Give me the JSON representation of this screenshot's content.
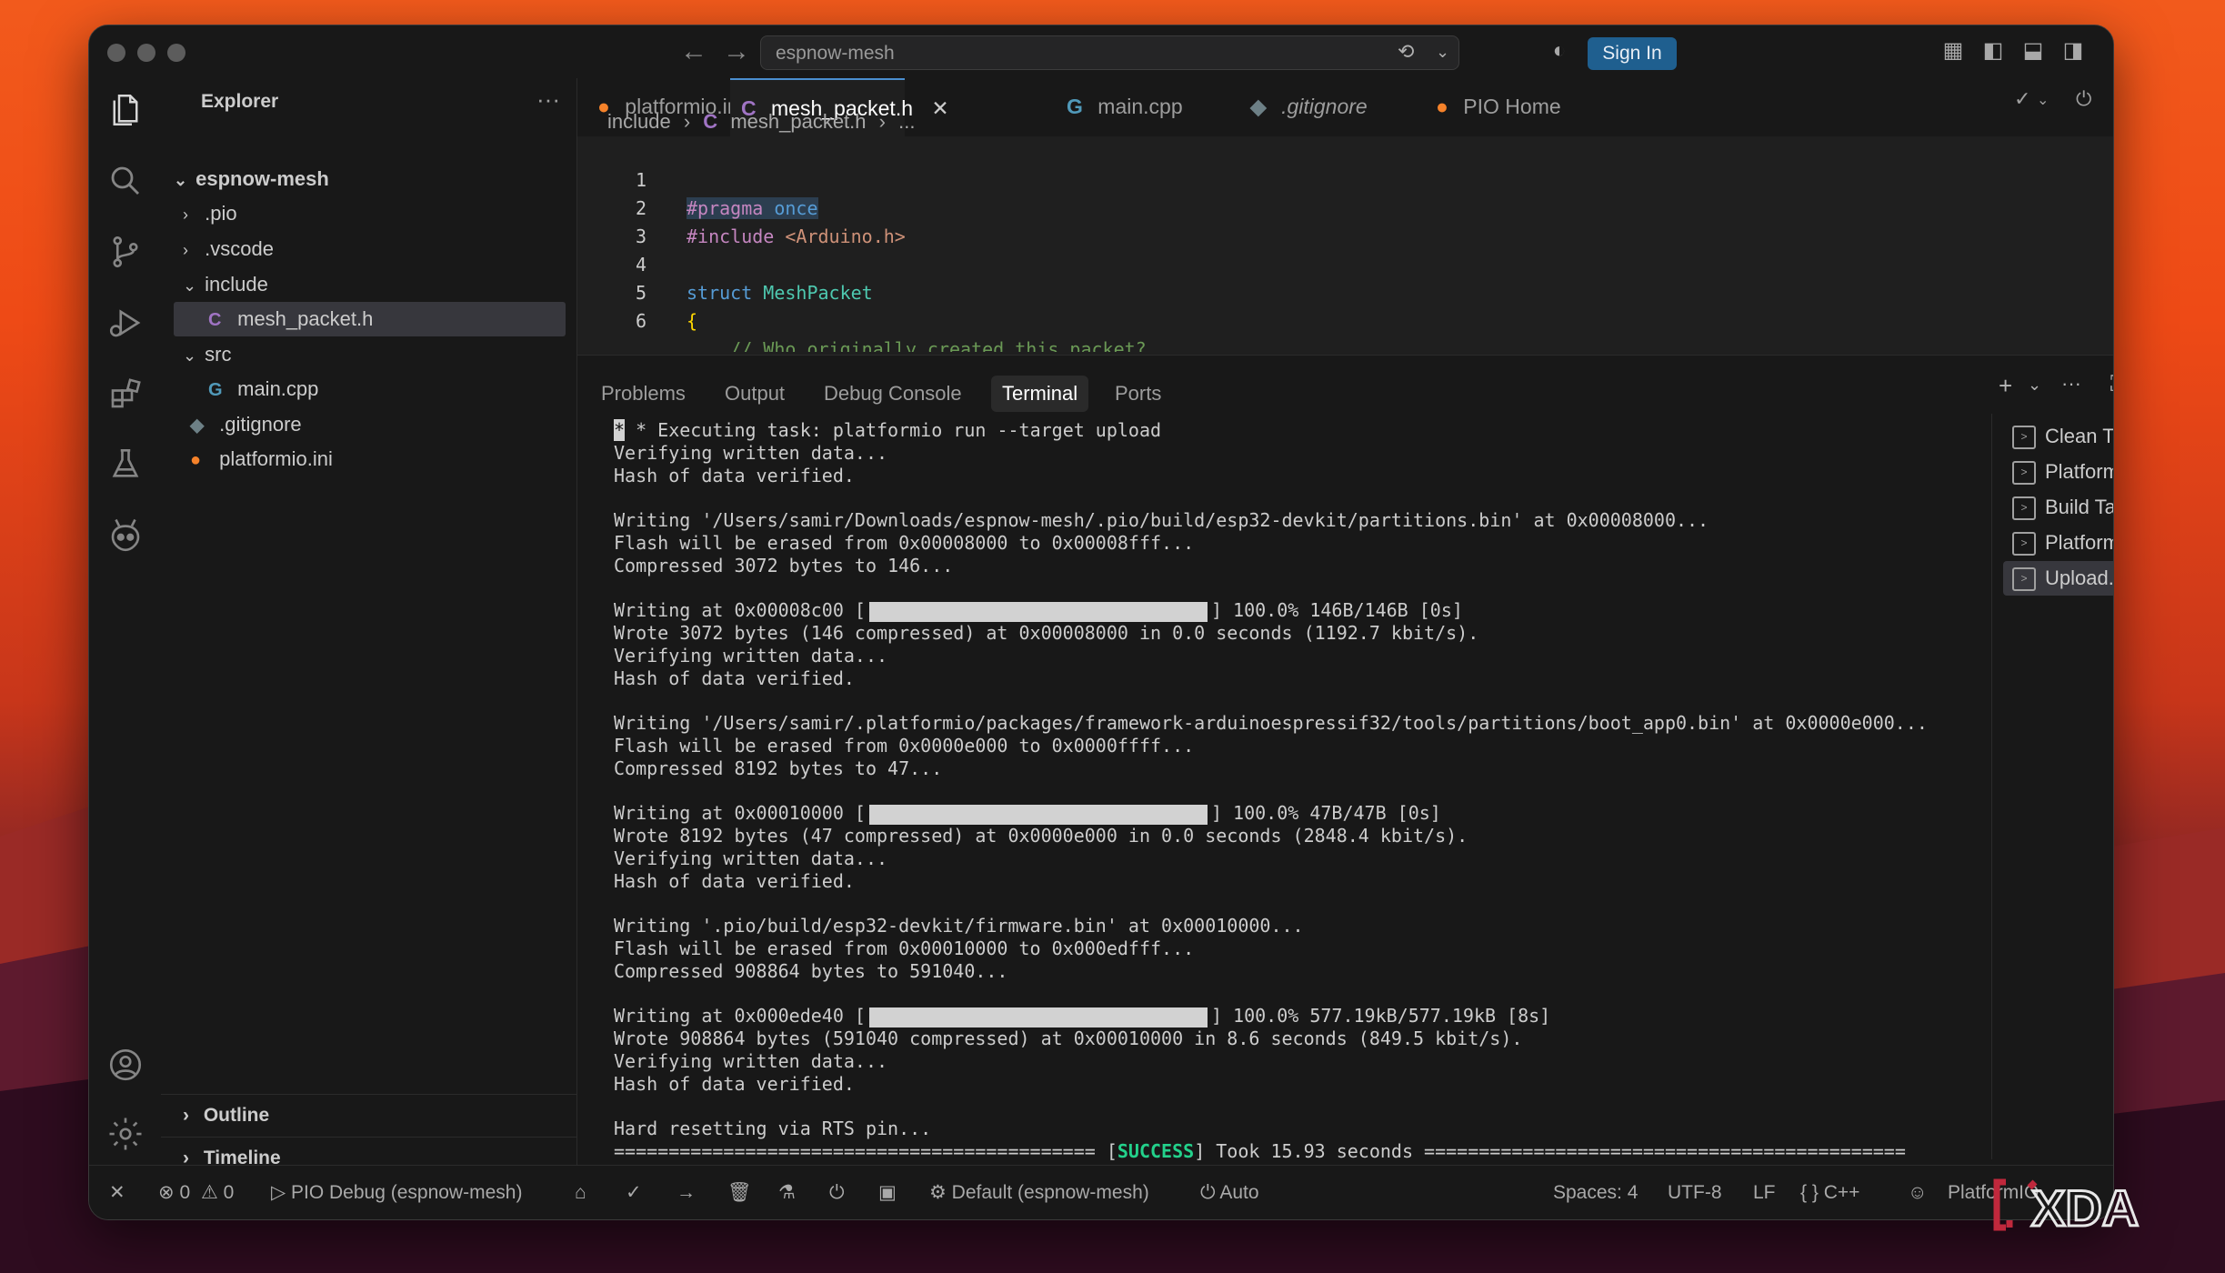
{
  "window": {
    "search_text": "espnow-mesh",
    "sign_in": "Sign In"
  },
  "sidebar": {
    "title": "Explorer",
    "root": "espnow-mesh",
    "items": [
      {
        "label": ".pio",
        "icon": "chevron-right"
      },
      {
        "label": ".vscode",
        "icon": "chevron-right"
      },
      {
        "label": "include",
        "icon": "chevron-down"
      },
      {
        "label": "mesh_packet.h",
        "icon": "c-file"
      },
      {
        "label": "src",
        "icon": "chevron-down"
      },
      {
        "label": "main.cpp",
        "icon": "cpp-file"
      },
      {
        "label": ".gitignore",
        "icon": "git-file"
      },
      {
        "label": "platformio.ini",
        "icon": "platformio-file"
      }
    ],
    "outline": "Outline",
    "timeline": "Timeline"
  },
  "tabs": [
    {
      "label": "platformio.ini",
      "icon": "platformio-icon"
    },
    {
      "label": "mesh_packet.h",
      "icon": "C",
      "active": true
    },
    {
      "label": "main.cpp",
      "icon": "cpp-icon"
    },
    {
      "label": ".gitignore",
      "icon": "git-icon"
    },
    {
      "label": "PIO Home",
      "icon": "platformio-icon"
    }
  ],
  "breadcrumb": {
    "folder": "include",
    "file": "mesh_packet.h",
    "rest": "..."
  },
  "code": [
    {
      "n": "1",
      "pre": "#pragma",
      "mid": " once",
      "post": ""
    },
    {
      "n": "2",
      "pre": "#include",
      "mid": " <Arduino.h>",
      "post": ""
    },
    {
      "n": "3",
      "pre": "",
      "mid": "",
      "post": ""
    },
    {
      "n": "4",
      "pre": "struct",
      "mid": " MeshPacket",
      "post": ""
    },
    {
      "n": "5",
      "pre": "{",
      "mid": "",
      "post": ""
    },
    {
      "n": "6",
      "pre": "    // Who originally created this packet?",
      "mid": "",
      "post": ""
    }
  ],
  "panel": {
    "tabs": [
      "Problems",
      "Output",
      "Debug Console",
      "Terminal",
      "Ports"
    ],
    "active_tab": "Terminal",
    "terminal": [
      " * Executing task: platformio run --target upload",
      "Verifying written data...",
      "Hash of data verified.",
      "",
      "Writing '/Users/samir/Downloads/espnow-mesh/.pio/build/esp32-devkit/partitions.bin' at 0x00008000...",
      "Flash will be erased from 0x00008000 to 0x00008fff...",
      "Compressed 3072 bytes to 146...",
      "",
      "Writing at 0x00008c00 [|] 100.0% 146B/146B [0s]",
      "Wrote 3072 bytes (146 compressed) at 0x00008000 in 0.0 seconds (1192.7 kbit/s).",
      "Verifying written data...",
      "Hash of data verified.",
      "",
      "Writing '/Users/samir/.platformio/packages/framework-arduinoespressif32/tools/partitions/boot_app0.bin' at 0x0000e000...",
      "Flash will be erased from 0x0000e000 to 0x0000ffff...",
      "Compressed 8192 bytes to 47...",
      "",
      "Writing at 0x00010000 [|] 100.0% 47B/47B [0s]",
      "Wrote 8192 bytes (47 compressed) at 0x0000e000 in 0.0 seconds (2848.4 kbit/s).",
      "Verifying written data...",
      "Hash of data verified.",
      "",
      "Writing '.pio/build/esp32-devkit/firmware.bin' at 0x00010000...",
      "Flash will be erased from 0x00010000 to 0x000edfff...",
      "Compressed 908864 bytes to 591040...",
      "",
      "Writing at 0x000ede40 [|] 100.0% 577.19kB/577.19kB [8s]",
      "Wrote 908864 bytes (591040 compressed) at 0x00010000 in 8.6 seconds (849.5 kbit/s).",
      "Verifying written data...",
      "Hash of data verified.",
      "",
      "Hard resetting via RTS pin...",
      "============================================ [SUCCESS] Took 15.93 seconds ============================================"
    ],
    "tasks": [
      {
        "label": "Clean T...",
        "check": true
      },
      {
        "label": "PlatformIO...",
        "check": false
      },
      {
        "label": "Build Ta...",
        "check": true
      },
      {
        "label": "PlatformIO...",
        "check": false
      },
      {
        "label": "Upload...",
        "check": true,
        "active": true
      }
    ]
  },
  "status": {
    "errors": "0",
    "warnings": "0",
    "debug": "PIO Debug (espnow-mesh)",
    "env": "Default (espnow-mesh)",
    "port": "Auto",
    "spaces": "Spaces: 4",
    "encoding": "UTF-8",
    "eol": "LF",
    "lang": "C++",
    "platformio": "PlatformIO"
  },
  "watermark": "XDA",
  "colors": {
    "accent": "#1f5f8f",
    "success": "#23d18b",
    "keyword": "#c586c0",
    "string": "#ce9178"
  }
}
